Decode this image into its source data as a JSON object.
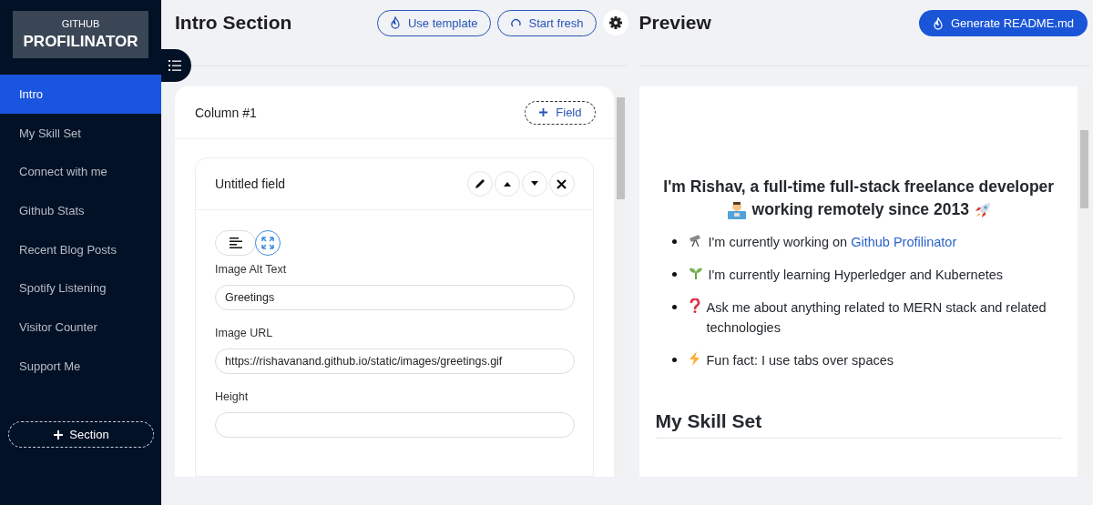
{
  "logo": {
    "top": "GITHUB",
    "main": "PROFILINATOR"
  },
  "sidebar": {
    "items": [
      {
        "label": "Intro",
        "selected": true
      },
      {
        "label": "My Skill Set",
        "selected": false
      },
      {
        "label": "Connect with me",
        "selected": false
      },
      {
        "label": "Github Stats",
        "selected": false
      },
      {
        "label": "Recent Blog Posts",
        "selected": false
      },
      {
        "label": "Spotify Listening",
        "selected": false
      },
      {
        "label": "Visitor Counter",
        "selected": false
      },
      {
        "label": "Support Me",
        "selected": false
      }
    ],
    "add_button": "Section"
  },
  "editor": {
    "title": "Intro Section",
    "buttons": [
      "Use template",
      "Start fresh"
    ],
    "column": {
      "title": "Column #1",
      "add_button": "Field"
    },
    "field": {
      "title": "Untitled field",
      "align_modes": [
        {
          "kind": "text",
          "selected": false
        },
        {
          "kind": "expand",
          "selected": true
        }
      ],
      "inputs": [
        {
          "label": "Image Alt Text",
          "value": "Greetings"
        },
        {
          "label": "Image URL",
          "value": "https://rishavanand.github.io/static/images/greetings.gif"
        },
        {
          "label": "Height"
        }
      ]
    }
  },
  "preview": {
    "title": "Preview",
    "generate_button": "Generate README.md",
    "heading": [
      "I'm Rishav, a full-time full-stack freelance developer",
      "working remotely since 2013"
    ],
    "bullets": [
      {
        "kind": "telescope",
        "text": "I'm currently working on",
        "link": "Github Profilinator"
      },
      {
        "kind": "seedling",
        "text": "I'm currently learning Hyperledger and Kubernetes"
      },
      {
        "kind": "question",
        "text": "Ask me about anything related to MERN stack and related technologies"
      },
      {
        "kind": "bolt",
        "text": "Fun fact: I use tabs over spaces"
      }
    ],
    "section_title": "My Skill Set"
  }
}
